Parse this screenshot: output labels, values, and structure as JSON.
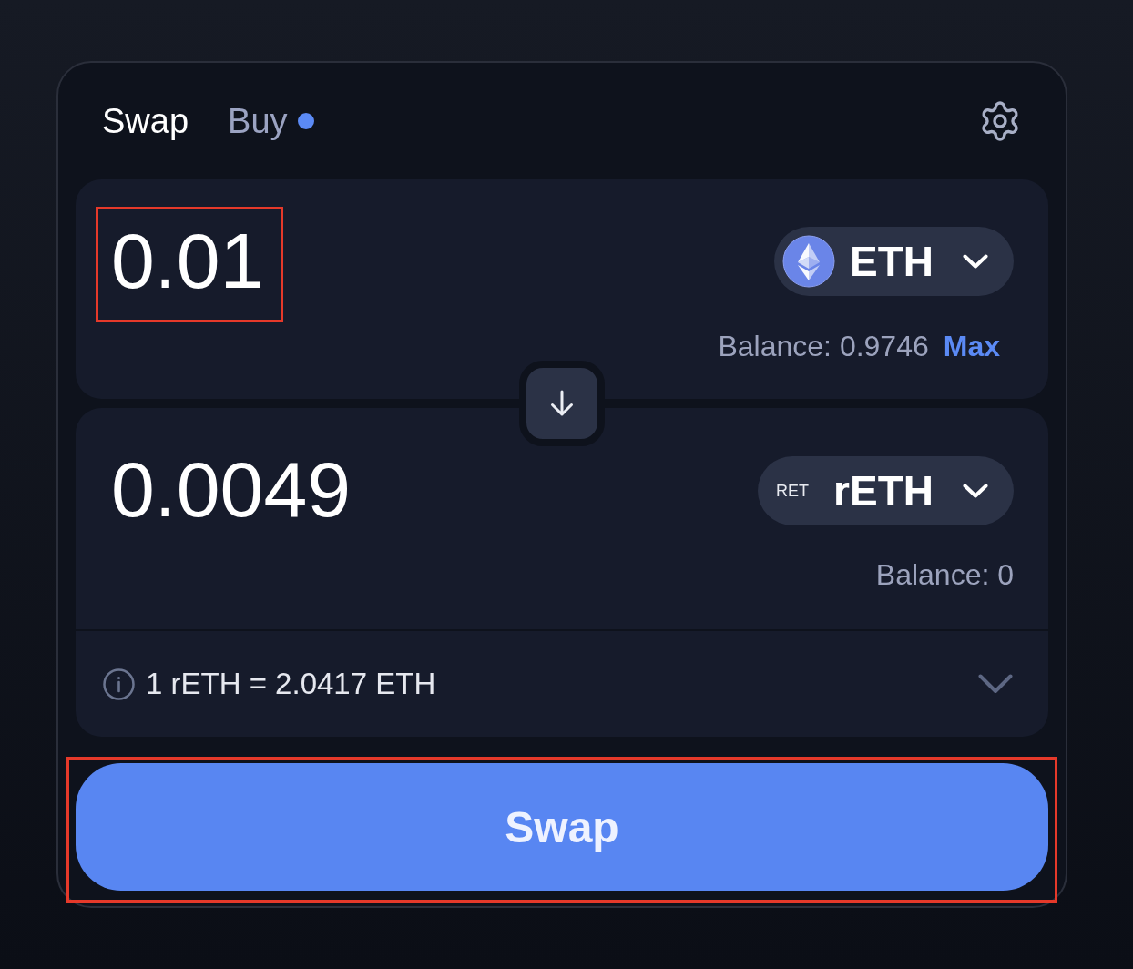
{
  "tabs": [
    {
      "label": "Swap",
      "selected": true,
      "dot": false
    },
    {
      "label": "Buy",
      "selected": false,
      "dot": true
    }
  ],
  "from": {
    "amount": "0.01",
    "highlighted": true,
    "token": {
      "symbol": "ETH",
      "icon": {
        "kind": "logo"
      }
    },
    "balance": "Balance: 0.9746",
    "max_label": "Max"
  },
  "to": {
    "amount": "0.0049",
    "highlighted": false,
    "token": {
      "symbol": "rETH",
      "icon": {
        "kind": "text",
        "text": "RET"
      }
    },
    "balance": "Balance: 0"
  },
  "rate": {
    "text": "1 rETH = 2.0417 ETH",
    "expanded": false
  },
  "swap_button": {
    "label": "Swap",
    "highlighted": true
  }
}
